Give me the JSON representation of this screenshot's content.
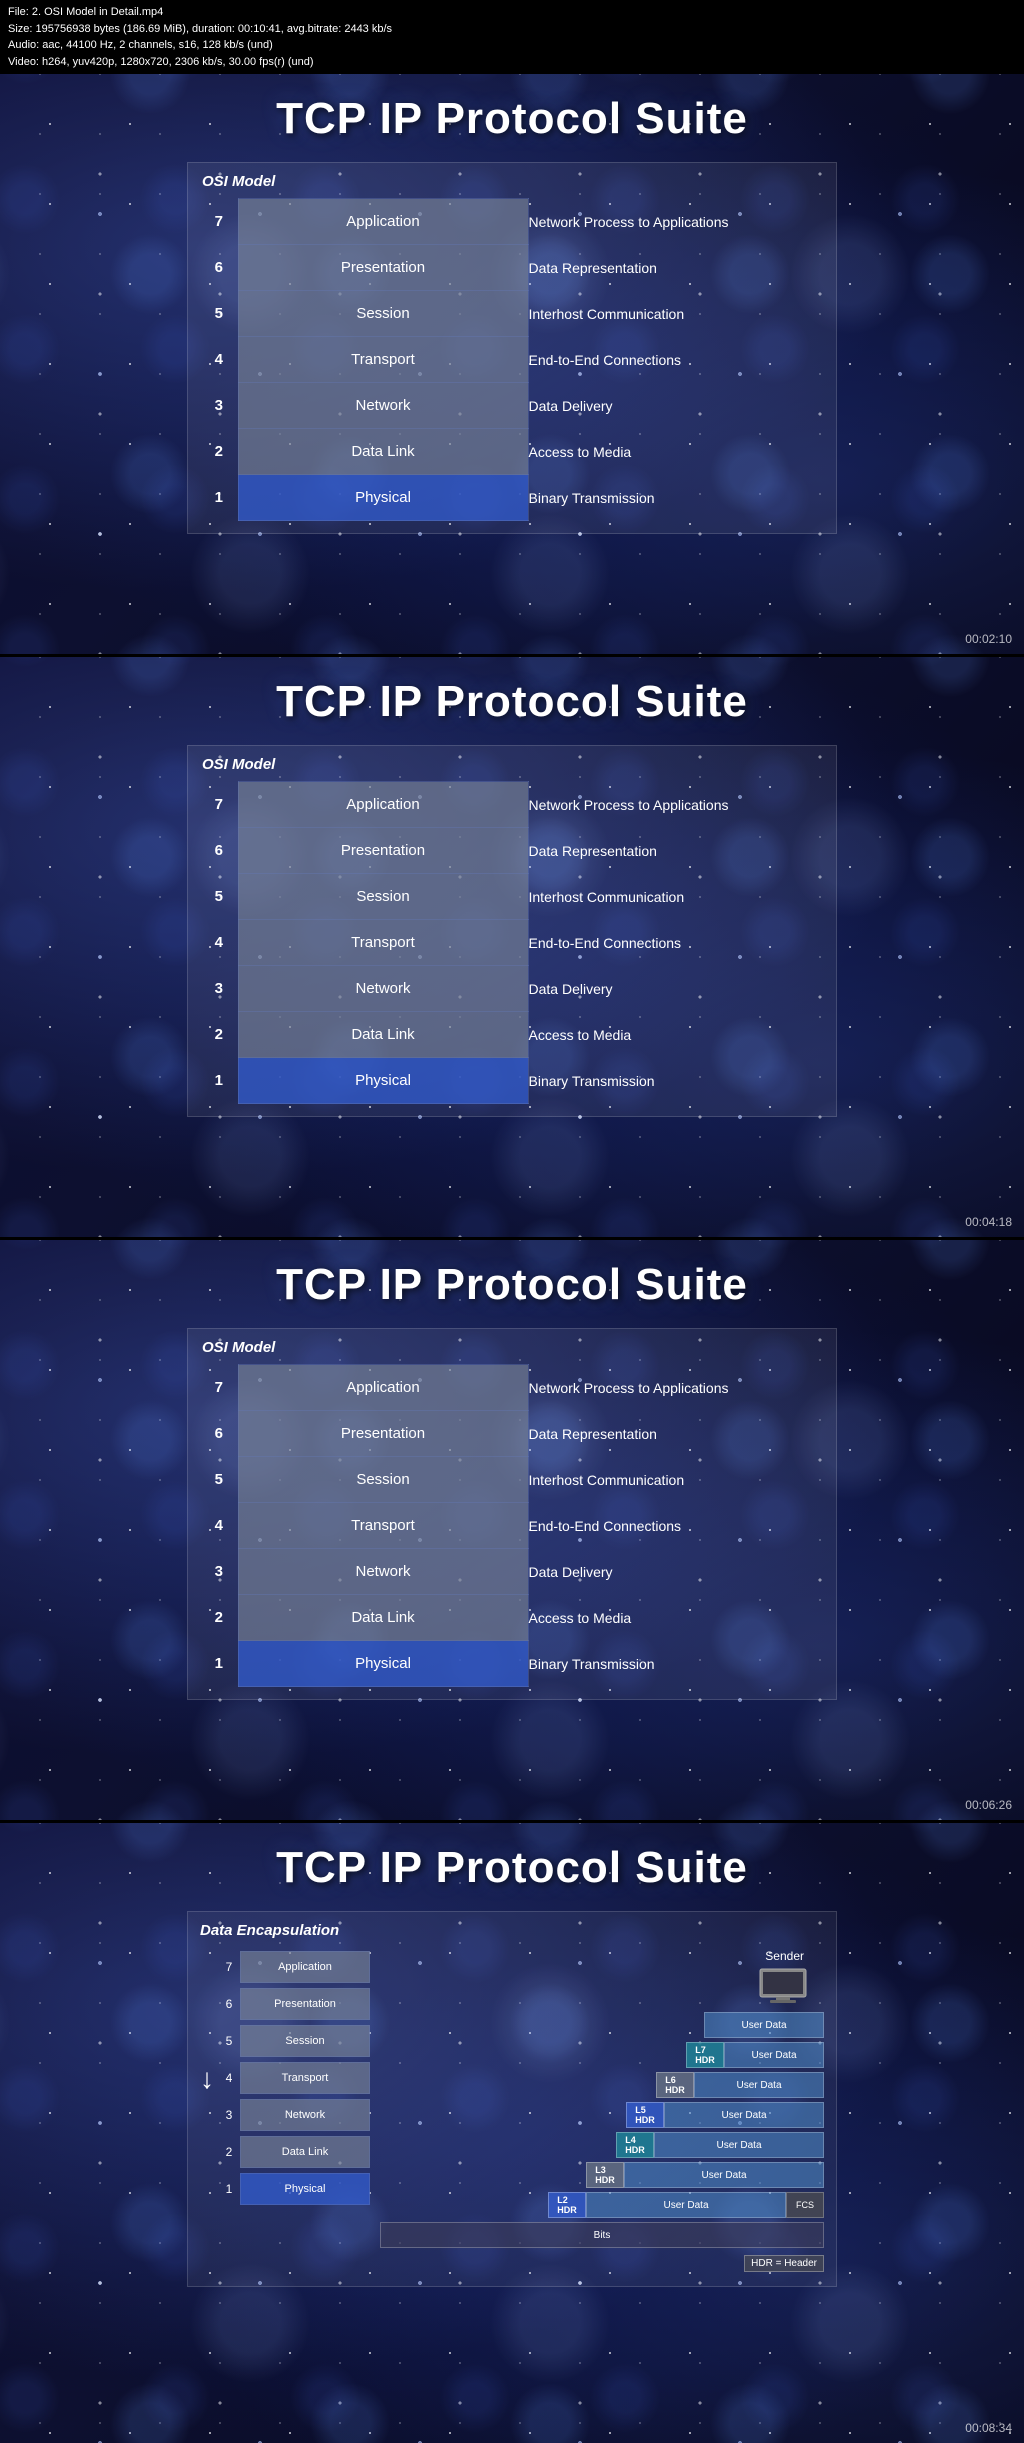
{
  "fileInfo": {
    "line1": "File: 2. OSI Model in Detail.mp4",
    "line2": "Size: 195756938 bytes (186.69 MiB), duration: 00:10:41, avg.bitrate: 2443 kb/s",
    "line3": "Audio: aac, 44100 Hz, 2 channels, s16, 128 kb/s (und)",
    "line4": "Video: h264, yuv420p, 1280x720, 2306 kb/s, 30.00 fps(r) (und)"
  },
  "slides": [
    {
      "title": "TCP IP Protocol Suite",
      "osiLabel": "OSI Model",
      "timestamp": "00:02:10",
      "layers": [
        {
          "num": "7",
          "name": "Application",
          "desc": "Network Process to Applications",
          "style": "gray"
        },
        {
          "num": "6",
          "name": "Presentation",
          "desc": "Data Representation",
          "style": "gray"
        },
        {
          "num": "5",
          "name": "Session",
          "desc": "Interhost Communication",
          "style": "gray"
        },
        {
          "num": "4",
          "name": "Transport",
          "desc": "End-to-End Connections",
          "style": "gray"
        },
        {
          "num": "3",
          "name": "Network",
          "desc": "Data Delivery",
          "style": "gray"
        },
        {
          "num": "2",
          "name": "Data Link",
          "desc": "Access to Media",
          "style": "gray"
        },
        {
          "num": "1",
          "name": "Physical",
          "desc": "Binary Transmission",
          "style": "blue"
        }
      ]
    },
    {
      "title": "TCP IP Protocol Suite",
      "osiLabel": "OSI Model",
      "timestamp": "00:04:18",
      "layers": [
        {
          "num": "7",
          "name": "Application",
          "desc": "Network Process to Applications",
          "style": "gray"
        },
        {
          "num": "6",
          "name": "Presentation",
          "desc": "Data Representation",
          "style": "gray"
        },
        {
          "num": "5",
          "name": "Session",
          "desc": "Interhost Communication",
          "style": "gray"
        },
        {
          "num": "4",
          "name": "Transport",
          "desc": "End-to-End Connections",
          "style": "gray"
        },
        {
          "num": "3",
          "name": "Network",
          "desc": "Data Delivery",
          "style": "gray"
        },
        {
          "num": "2",
          "name": "Data Link",
          "desc": "Access to Media",
          "style": "gray"
        },
        {
          "num": "1",
          "name": "Physical",
          "desc": "Binary Transmission",
          "style": "blue"
        }
      ]
    },
    {
      "title": "TCP IP Protocol Suite",
      "osiLabel": "OSI Model",
      "timestamp": "00:06:26",
      "layers": [
        {
          "num": "7",
          "name": "Application",
          "desc": "Network Process to Applications",
          "style": "gray"
        },
        {
          "num": "6",
          "name": "Presentation",
          "desc": "Data Representation",
          "style": "gray"
        },
        {
          "num": "5",
          "name": "Session",
          "desc": "Interhost Communication",
          "style": "gray"
        },
        {
          "num": "4",
          "name": "Transport",
          "desc": "End-to-End Connections",
          "style": "gray"
        },
        {
          "num": "3",
          "name": "Network",
          "desc": "Data Delivery",
          "style": "gray"
        },
        {
          "num": "2",
          "name": "Data Link",
          "desc": "Access to Media",
          "style": "gray"
        },
        {
          "num": "1",
          "name": "Physical",
          "desc": "Binary Transmission",
          "style": "blue"
        }
      ]
    }
  ],
  "slide4": {
    "title": "TCP IP Protocol Suite",
    "encapLabel": "Data Encapsulation",
    "senderLabel": "Sender",
    "timestamp": "00:08:34",
    "osiLayers": [
      {
        "num": "7",
        "name": "Application",
        "style": "gray"
      },
      {
        "num": "6",
        "name": "Presentation",
        "style": "gray"
      },
      {
        "num": "5",
        "name": "Session",
        "style": "gray"
      },
      {
        "num": "4",
        "name": "Transport",
        "style": "gray"
      },
      {
        "num": "3",
        "name": "Network",
        "style": "gray"
      },
      {
        "num": "2",
        "name": "Data Link",
        "style": "gray"
      },
      {
        "num": "1",
        "name": "Physical",
        "style": "blue"
      }
    ],
    "stacks": [
      {
        "label": "User Data",
        "hdrs": []
      },
      {
        "label": "User Data",
        "hdrs": [
          "L7 HDR"
        ]
      },
      {
        "label": "User Data",
        "hdrs": [
          "L6 HDR"
        ]
      },
      {
        "label": "User Data",
        "hdrs": [
          "L5 HDR"
        ]
      },
      {
        "label": "User Data",
        "hdrs": [
          "L4 HDR"
        ]
      },
      {
        "label": "User Data",
        "hdrs": [
          "L3 HDR"
        ]
      },
      {
        "label": "User Data",
        "hdrs": [
          "L2 HDR"
        ],
        "fcs": "FCS"
      },
      {
        "label": "Bits",
        "hdrs": []
      }
    ],
    "legendLabel": "HDR = Header"
  }
}
